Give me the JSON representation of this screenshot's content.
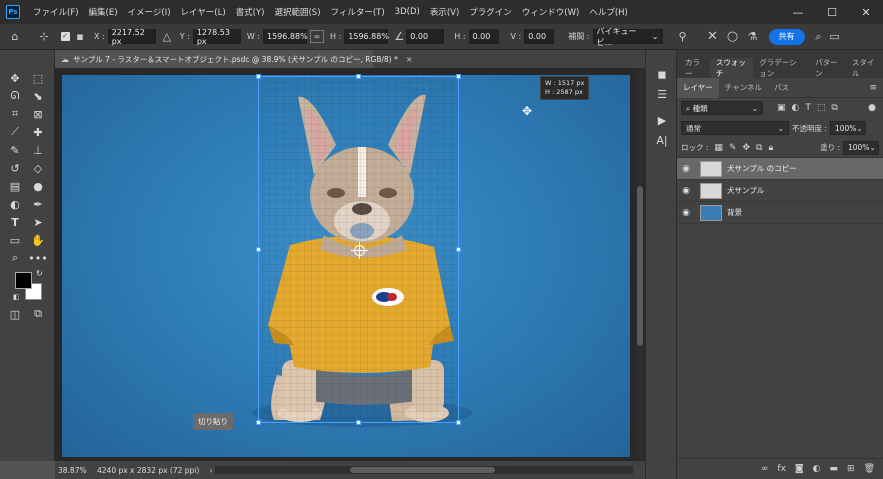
{
  "app": {
    "logo": "Ps"
  },
  "menu": [
    "ファイル(F)",
    "編集(E)",
    "イメージ(I)",
    "レイヤー(L)",
    "書式(Y)",
    "選択範囲(S)",
    "フィルター(T)",
    "3D(D)",
    "表示(V)",
    "プラグイン",
    "ウィンドウ(W)",
    "ヘルプ(H)"
  ],
  "options": {
    "x_label": "X :",
    "x_value": "2217.52 px",
    "y_label": "Y :",
    "y_value": "1278.53 px",
    "w_label": "W :",
    "w_value": "1596.88%",
    "h_label": "H :",
    "h_value": "1596.88%",
    "rot_value": "0.00",
    "hskew_label": "H :",
    "hskew_value": "0.00",
    "vskew_label": "V :",
    "vskew_value": "0.00",
    "interp_label": "補間 :",
    "interp_value": "バイキュービ...",
    "share_label": "共有"
  },
  "document": {
    "tab_title": "サンプル 7 - ラスター＆スマートオブジェクト.psdc @ 38.9% (犬サンプル のコピー, RGB/8) *",
    "close_symbol": "×",
    "tooltip_w": "W : 1517 px",
    "tooltip_h": "H : 2587 px",
    "cut_tooltip": "切り貼り"
  },
  "status": {
    "zoom": "38.87%",
    "info": "4240 px x 2832 px (72 ppi)",
    "arrow": "›"
  },
  "panels": {
    "top_tabs": [
      "カラー",
      "スウォッチ",
      "グラデーション",
      "パターン",
      "スタイル"
    ],
    "top_active": 1,
    "sub_tabs": [
      "レイヤー",
      "チャンネル",
      "パス"
    ],
    "sub_active": 0,
    "filter_value": "種類",
    "blend_value": "通常",
    "opacity_label": "不透明度 :",
    "opacity_value": "100%",
    "lock_label": "ロック :",
    "fill_label": "塗り :",
    "fill_value": "100%",
    "layers": [
      {
        "name": "犬サンプル のコピー",
        "selected": true,
        "thumb": "#d8d8d8"
      },
      {
        "name": "犬サンプル",
        "selected": false,
        "thumb": "#d8d8d8"
      },
      {
        "name": "背景",
        "selected": false,
        "thumb": "#3a7db5"
      }
    ]
  },
  "colors": {
    "accent": "#1473e6",
    "selection": "#4aa0ff",
    "backdrop": "#2f7db7",
    "shirt": "#e3a92e"
  }
}
